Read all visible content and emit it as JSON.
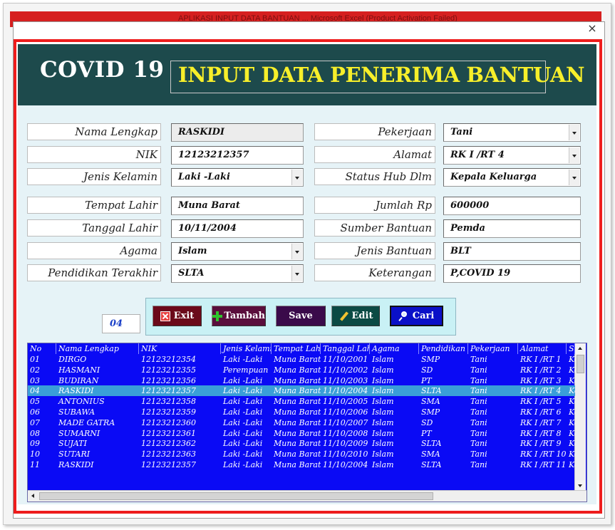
{
  "behind_window_title": "APLIKASI INPUT DATA BANTUAN ... Microsoft Excel (Product Activation Failed)",
  "dialog": {
    "close_glyph": "×"
  },
  "header": {
    "left_title": "COVID 19",
    "main_title": "INPUT DATA PENERIMA BANTUAN"
  },
  "form": {
    "left": [
      {
        "label": "Nama Lengkap",
        "value": "RASKIDI",
        "type": "text",
        "readonly": true
      },
      {
        "label": "NIK",
        "value": "12123212357",
        "type": "text"
      },
      {
        "label": "Jenis Kelamin",
        "value": "Laki -Laki",
        "type": "select"
      },
      {
        "label": "Tempat Lahir",
        "value": "Muna Barat",
        "type": "text"
      },
      {
        "label": "Tanggal Lahir",
        "value": "10/11/2004",
        "type": "text"
      },
      {
        "label": "Agama",
        "value": "Islam",
        "type": "select"
      },
      {
        "label": "Pendidikan Terakhir",
        "value": "SLTA",
        "type": "select"
      }
    ],
    "right": [
      {
        "label": "Pekerjaan",
        "value": "Tani",
        "type": "select"
      },
      {
        "label": "Alamat",
        "value": "RK I /RT 4",
        "type": "select"
      },
      {
        "label": "Status Hub Dlm",
        "value": "Kepala Keluarga",
        "type": "select"
      },
      {
        "label": "Jumlah Rp",
        "value": "600000",
        "type": "text"
      },
      {
        "label": "Sumber Bantuan",
        "value": "Pemda",
        "type": "text"
      },
      {
        "label": "Jenis Bantuan",
        "value": "BLT",
        "type": "text"
      },
      {
        "label": "Keterangan",
        "value": "P,COVID 19",
        "type": "text"
      }
    ]
  },
  "record_counter": "04",
  "buttons": {
    "exit": {
      "label": "Exit",
      "icon": "close-box-icon",
      "color": "#6b0a1a"
    },
    "tambah": {
      "label": "Tambah",
      "icon": "plus-icon",
      "color": "#5a0e3c"
    },
    "save": {
      "label": "Save",
      "icon": "",
      "color": "#3a0a4a"
    },
    "edit": {
      "label": "Edit",
      "icon": "pencil-icon",
      "color": "#0b4a44"
    },
    "cari": {
      "label": "Cari",
      "icon": "search-icon",
      "color": "#0a10c8"
    }
  },
  "grid": {
    "columns": [
      "No",
      "Nama Lengkap",
      "NIK",
      "Jenis Kelamin",
      "Tempat Lahir",
      "Tanggal Lahir",
      "Agama",
      "Pendidikan Terakhir",
      "Pekerjaan",
      "Alamat",
      "Status Hub Dlm"
    ],
    "selected_row": 3,
    "rows": [
      [
        "01",
        "DIRGO",
        "12123212354",
        "Laki -Laki",
        "Muna Barat",
        "11/10/2001",
        "Islam",
        "SMP",
        "Tani",
        "RK I /RT 1",
        "Kepala Keluarga"
      ],
      [
        "02",
        "HASMANI",
        "12123212355",
        "Perempuan",
        "Muna Barat",
        "11/10/2002",
        "Islam",
        "SD",
        "Tani",
        "RK I /RT 2",
        "Kepala Keluarga"
      ],
      [
        "03",
        "BUDIRAN",
        "12123212356",
        "Laki -Laki",
        "Muna Barat",
        "11/10/2003",
        "Islam",
        "PT",
        "Tani",
        "RK I /RT 3",
        "Kepala Keluarga"
      ],
      [
        "04",
        "RASKIDI",
        "12123212357",
        "Laki -Laki",
        "Muna Barat",
        "11/10/2004",
        "Islam",
        "SLTA",
        "Tani",
        "RK I /RT 4",
        "Kepala Keluarga"
      ],
      [
        "05",
        "ANTONIUS",
        "12123212358",
        "Laki -Laki",
        "Muna Barat",
        "11/10/2005",
        "Islam",
        "SMA",
        "Tani",
        "RK I /RT 5",
        "Kepala Keluarga"
      ],
      [
        "06",
        "SUBAWA",
        "12123212359",
        "Laki -Laki",
        "Muna Barat",
        "11/10/2006",
        "Islam",
        "SMP",
        "Tani",
        "RK I /RT 6",
        "Kepala Keluarga"
      ],
      [
        "07",
        "MADE GATRA",
        "12123212360",
        "Laki -Laki",
        "Muna Barat",
        "11/10/2007",
        "Islam",
        "SD",
        "Tani",
        "RK I /RT 7",
        "Kepala Keluarga"
      ],
      [
        "08",
        "SUMARNI",
        "12123212361",
        "Laki -Laki",
        "Muna Barat",
        "11/10/2008",
        "Islam",
        "PT",
        "Tani",
        "RK I /RT 8",
        "Kepala Keluarga"
      ],
      [
        "09",
        "SUJATI",
        "12123212362",
        "Laki -Laki",
        "Muna Barat",
        "11/10/2009",
        "Islam",
        "SLTA",
        "Tani",
        "RK I /RT 9",
        "Kepala Keluarga"
      ],
      [
        "10",
        "SUTARI",
        "12123212363",
        "Laki -Laki",
        "Muna Barat",
        "11/10/2010",
        "Islam",
        "SMA",
        "Tani",
        "RK I /RT 10",
        "Kepala Keluarga"
      ],
      [
        "11",
        "RASKIDI",
        "12123212357",
        "Laki -Laki",
        "Muna Barat",
        "11/10/2004",
        "Islam",
        "SLTA",
        "Tani",
        "RK I /RT 11",
        "Kepala Keluarga"
      ]
    ]
  },
  "colors": {
    "frame_red": "#ee1c1c",
    "header_bg": "#1d4a4c",
    "title_yellow": "#f7ef2a",
    "form_bg": "#e6f3f7",
    "grid_bg": "#0a0af5",
    "grid_selected": "#3a9fd8"
  }
}
